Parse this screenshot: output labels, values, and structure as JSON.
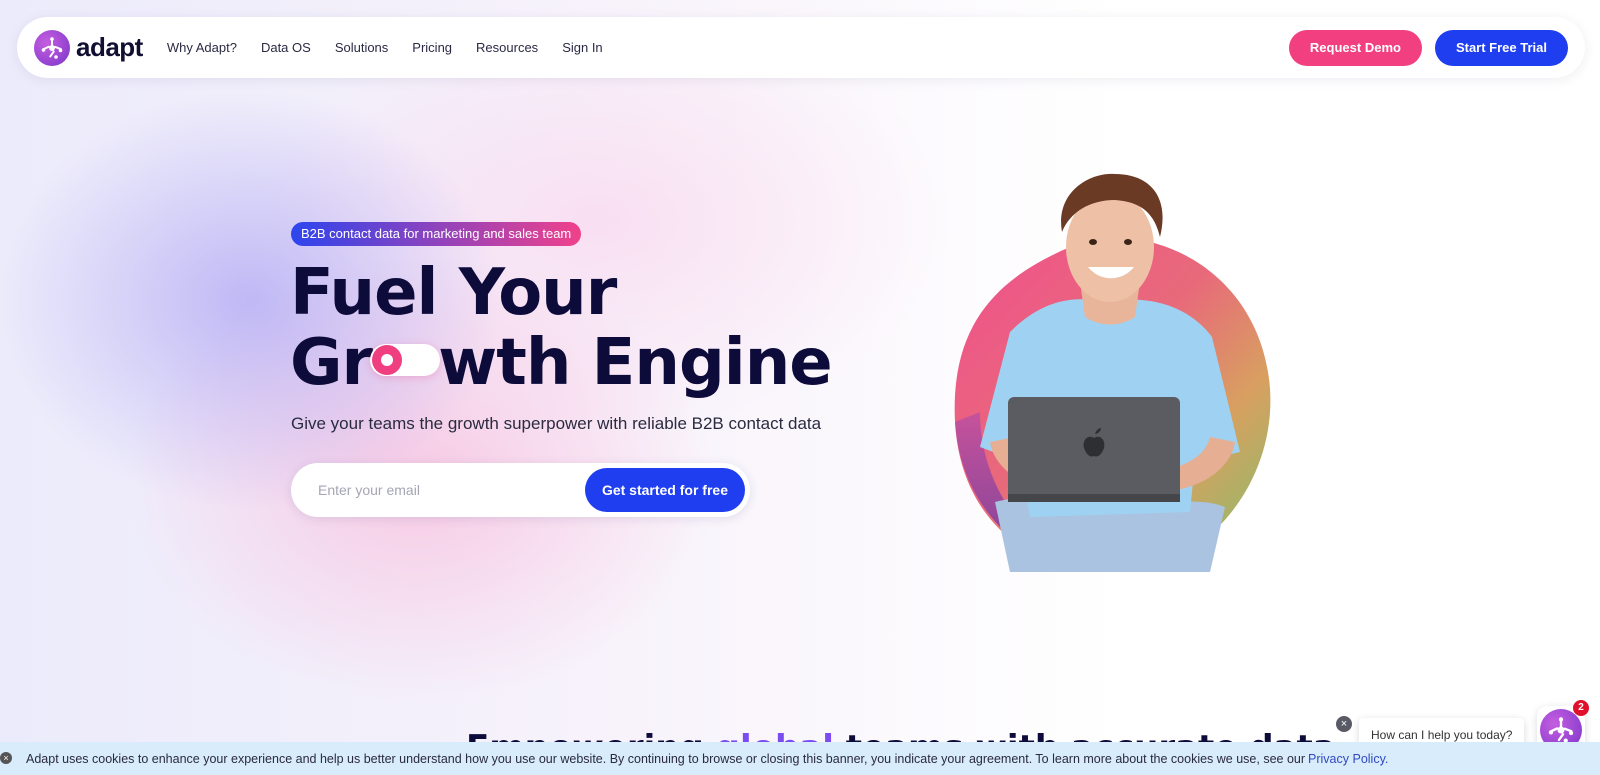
{
  "brand": {
    "name": "adapt"
  },
  "nav": {
    "links": [
      "Why Adapt?",
      "Data OS",
      "Solutions",
      "Pricing",
      "Resources",
      "Sign In"
    ],
    "request_demo": "Request Demo",
    "start_trial": "Start Free Trial"
  },
  "hero": {
    "badge": "B2B contact data for marketing and sales team",
    "title_line1": "Fuel Your",
    "title_line2_pre": "Gr",
    "title_line2_post": "wth Engine",
    "subtitle": "Give your teams the growth superpower with reliable B2B contact data",
    "email_placeholder": "Enter your email",
    "cta": "Get started for free"
  },
  "section": {
    "heading_pre": "Empowering ",
    "heading_accent": "global",
    "heading_post": " teams with accurate data"
  },
  "cookie": {
    "text": "Adapt uses cookies to enhance your experience and help us better understand how you use our website. By continuing to browse or closing this banner, you indicate your agreement. To learn more about the cookies we use, see our",
    "link": "Privacy Policy."
  },
  "chat": {
    "prompt": "How can I help you today?",
    "badge_count": "2"
  },
  "colors": {
    "primary_blue": "#1f3ef0",
    "primary_pink": "#f23f7f",
    "brand_purple": "#7a35c9"
  }
}
